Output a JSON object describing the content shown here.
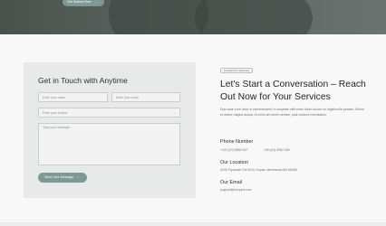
{
  "hero": {
    "cta_label": "Get Started Now",
    "cta_icon": "arrow-right-icon"
  },
  "form": {
    "title": "Get in Touch with Anytime",
    "name_placeholder": "Enter your name",
    "email_placeholder": "Enter your email",
    "subject_placeholder": "Enter your subject",
    "message_placeholder": "Type your message...",
    "submit_label": "Send Your Message",
    "submit_icon": "arrow-right-icon"
  },
  "info": {
    "badge": "Contact For Services",
    "heading": "Let's Start a Conversation – Reach Out Now for Your Services",
    "paragraph": "Duis aute irure dolor in reprehenderit in voluptate velit esse cillum dolore eu fugiat nulla pariatur. Minim et dolore magna aliqua. Ut enim ad minim veniam, quis nostrud exercitation.",
    "phone_label": "Phone Number",
    "phone_1": "+123 (27) 8652 527",
    "phone_2": "+26 (04) 9982 250",
    "location_label": "Our Location",
    "location_value": "3230 Plymouth Rd #100, Koplar, Minnesota MN 55366",
    "email_label": "Our Email",
    "email_value": "support@nexpert.com"
  },
  "colors": {
    "accent": "#7e9993",
    "card": "#e8eae9",
    "hero_dark": "#4a524e"
  }
}
